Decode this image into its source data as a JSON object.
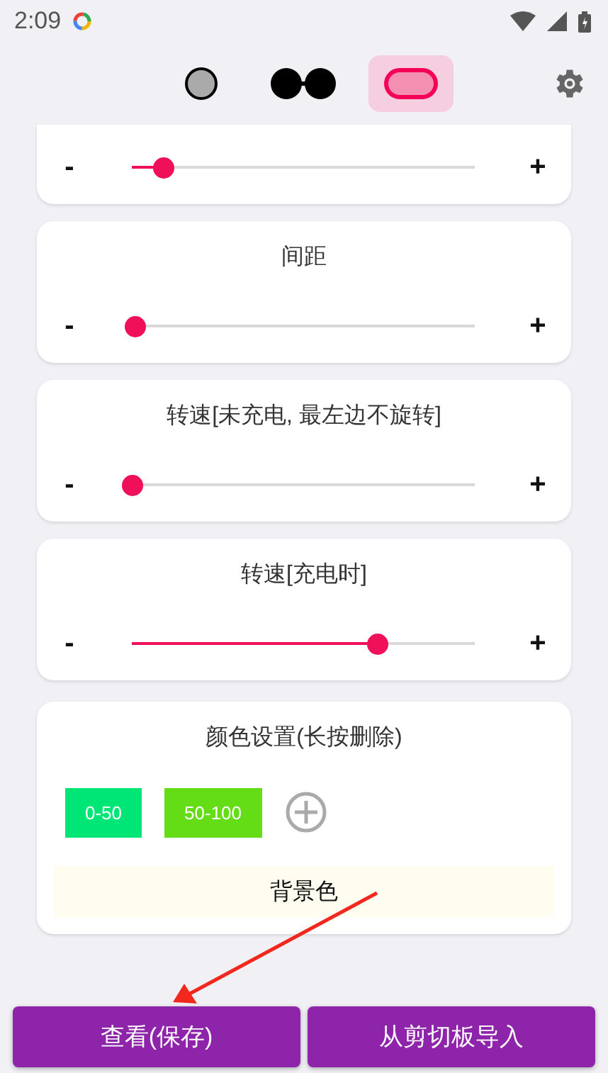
{
  "status_bar": {
    "time": "2:09"
  },
  "modes": [
    {
      "kind": "dot",
      "selected": false
    },
    {
      "kind": "double-dot",
      "selected": false
    },
    {
      "kind": "pill",
      "selected": true
    }
  ],
  "sliders": [
    {
      "minus": "-",
      "plus": "+",
      "level": 0.09
    },
    {
      "title": "间距",
      "minus": "-",
      "plus": "+",
      "level": 0.01
    },
    {
      "title": "转速[未充电, 最左边不旋转]",
      "minus": "-",
      "plus": "+",
      "level": 0
    },
    {
      "title": "转速[充电时]",
      "minus": "-",
      "plus": "+",
      "level": 0.715
    }
  ],
  "color_settings": {
    "title": "颜色设置(长按删除)",
    "ranges": [
      {
        "label": "0-50",
        "color": "#00e676"
      },
      {
        "label": "50-100",
        "color": "#64dd17"
      }
    ],
    "background_label": "背景色"
  },
  "annotation": {
    "kind": "arrow"
  },
  "buttons": [
    "查看(保存)",
    "从剪切板导入"
  ]
}
